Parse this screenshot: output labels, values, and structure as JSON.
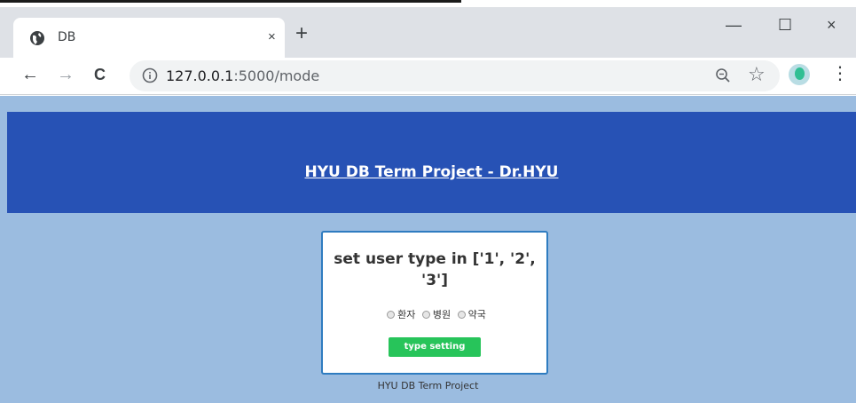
{
  "browser": {
    "tab_title": "DB",
    "close_tab_glyph": "×",
    "new_tab_glyph": "+",
    "minimize_glyph": "—",
    "maximize_glyph": "☐",
    "close_window_glyph": "×",
    "back_glyph": "←",
    "forward_glyph": "→",
    "reload_glyph": "C",
    "url_host": "127.0.0.1",
    "url_rest": ":5000/mode",
    "star_glyph": "☆",
    "menu_glyph": "⋮",
    "icons": [
      "globe-icon",
      "info-icon",
      "zoom-icon",
      "star-icon",
      "avatar",
      "menu-icon"
    ]
  },
  "page": {
    "site_title": "HYU DB Term Project - Dr.HYU",
    "card": {
      "heading_line1": "set user type in ['1', '2',",
      "heading_line2": "'3']",
      "options": [
        {
          "label": "환자",
          "checked": false
        },
        {
          "label": "병원",
          "checked": false
        },
        {
          "label": "약국",
          "checked": false
        }
      ],
      "button_label": "type setting"
    },
    "footer": "HYU DB Term Project"
  },
  "colors": {
    "header_bg": "#2752b5",
    "page_bg": "#9bbce0",
    "card_border": "#2f7cc0",
    "button_bg": "#27c45a"
  }
}
